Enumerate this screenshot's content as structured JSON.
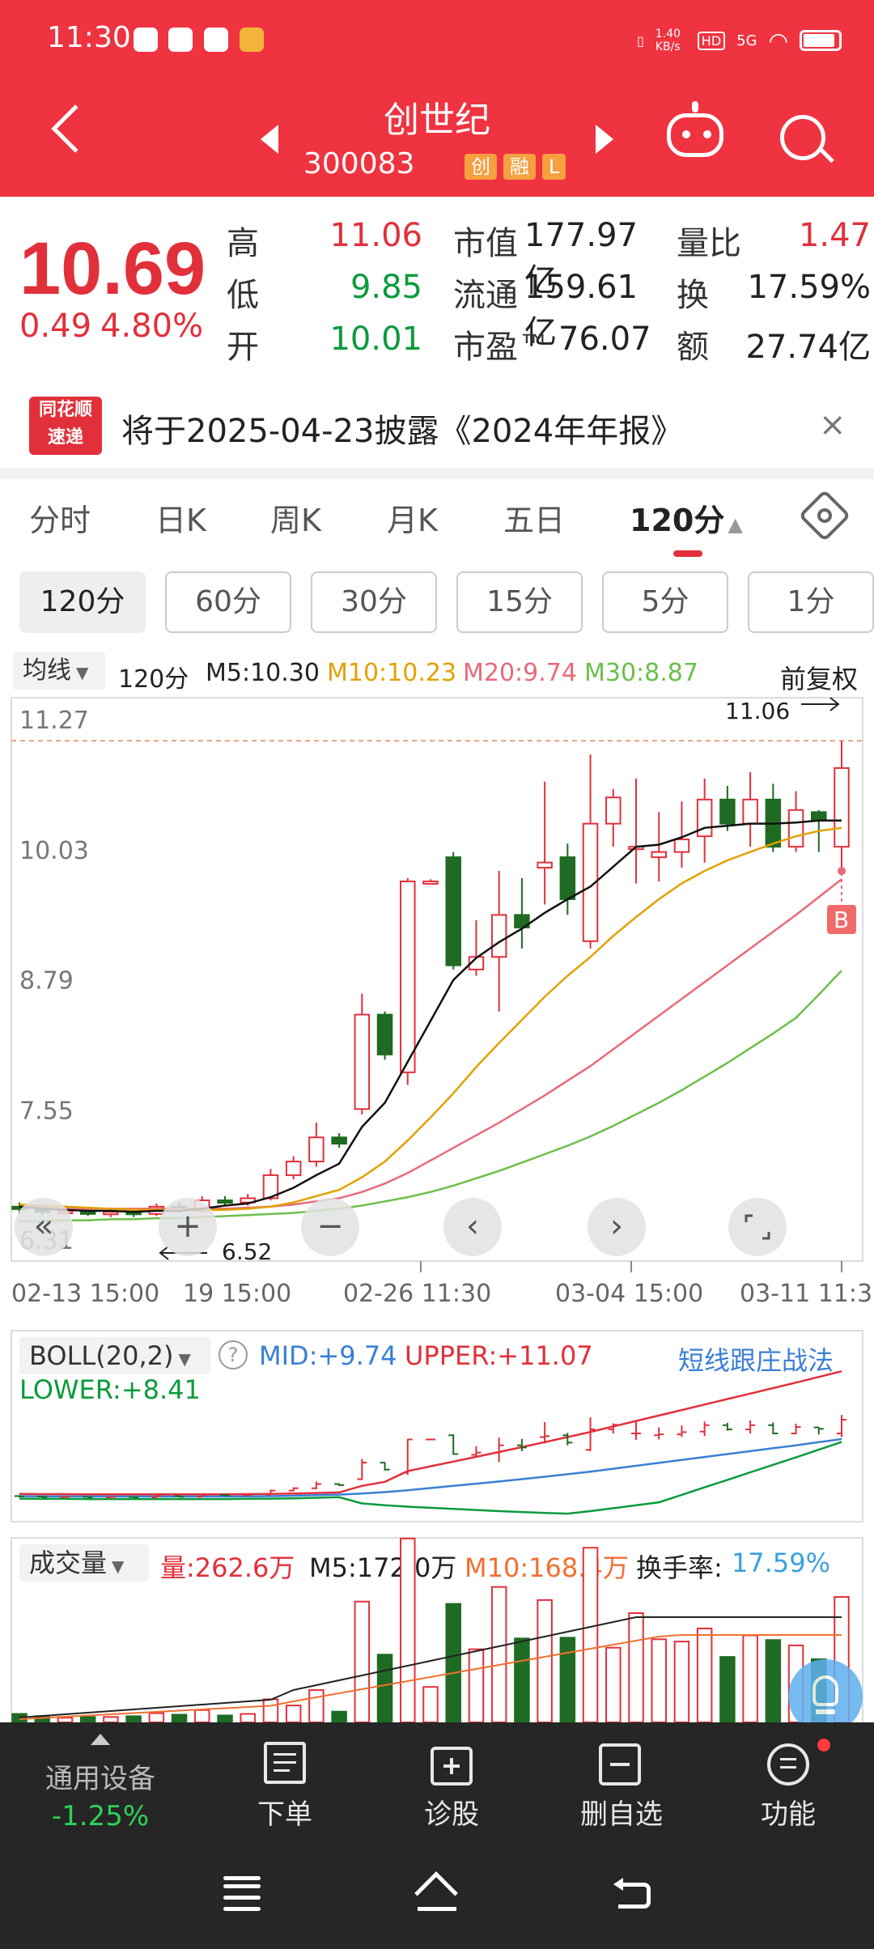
{
  "status": {
    "time": "11:30",
    "speed": "1.40\nKB/s",
    "hd": "HD",
    "signal": "5G"
  },
  "header": {
    "title": "创世纪",
    "code": "300083",
    "tags": [
      "创",
      "融",
      "L"
    ]
  },
  "quote": {
    "price": "10.69",
    "change": "0.49",
    "change_pct": "4.80%",
    "rows": [
      {
        "l1": "高",
        "v1": "11.06",
        "c1": "red",
        "l2": "市值",
        "v2": "177.97亿",
        "l3": "量比",
        "v3": "1.47",
        "c3": "red"
      },
      {
        "l1": "低",
        "v1": "9.85",
        "c1": "green",
        "l2": "流通",
        "v2": "159.61亿",
        "l3": "换",
        "v3": "17.59%",
        "c3": "dark"
      },
      {
        "l1": "开",
        "v1": "10.01",
        "c1": "green",
        "l2": "市盈™",
        "v2": "76.07",
        "l3": "额",
        "v3": "27.74亿",
        "c3": "dark"
      }
    ]
  },
  "notice": {
    "logo_top": "同花顺",
    "logo_bottom": "速递",
    "text": "将于2025-04-23披露《2024年年报》",
    "close": "×"
  },
  "tabs": [
    "分时",
    "日K",
    "周K",
    "月K",
    "五日",
    "120分"
  ],
  "periods": [
    "120分",
    "60分",
    "30分",
    "15分",
    "5分",
    "1分"
  ],
  "ma": {
    "select": "均线",
    "period": "120分",
    "m5": "M5:10.30",
    "m10": "M10:10.23",
    "m20": "M20:9.74",
    "m30": "M30:8.87",
    "adjust": "前复权"
  },
  "chart_data": {
    "type": "candlestick",
    "y_ticks": [
      "11.27",
      "10.03",
      "8.79",
      "7.55",
      "6.31"
    ],
    "ylim": [
      6.31,
      11.27
    ],
    "x_ticks": [
      "02-13 15:00",
      "19 15:00",
      "02-26 11:30",
      "03-04 15:00",
      "03-11 11:30"
    ],
    "high_label": "11.06",
    "low_label": "6.52",
    "buy_marker": "B",
    "colors": {
      "up": "#e2303b",
      "down": "#1f6b23",
      "m5": "#111111",
      "m10": "#e2a100",
      "m20": "#e86a7a",
      "m30": "#6cbf4a"
    },
    "candles": [
      {
        "o": 6.62,
        "c": 6.6,
        "h": 6.66,
        "l": 6.55
      },
      {
        "o": 6.6,
        "c": 6.57,
        "h": 6.62,
        "l": 6.54
      },
      {
        "o": 6.57,
        "c": 6.58,
        "h": 6.61,
        "l": 6.55
      },
      {
        "o": 6.58,
        "c": 6.55,
        "h": 6.6,
        "l": 6.53
      },
      {
        "o": 6.55,
        "c": 6.57,
        "h": 6.59,
        "l": 6.52
      },
      {
        "o": 6.57,
        "c": 6.55,
        "h": 6.6,
        "l": 6.52
      },
      {
        "o": 6.55,
        "c": 6.62,
        "h": 6.65,
        "l": 6.53
      },
      {
        "o": 6.62,
        "c": 6.58,
        "h": 6.66,
        "l": 6.56
      },
      {
        "o": 6.58,
        "c": 6.68,
        "h": 6.72,
        "l": 6.56
      },
      {
        "o": 6.68,
        "c": 6.66,
        "h": 6.72,
        "l": 6.63
      },
      {
        "o": 6.66,
        "c": 6.7,
        "h": 6.74,
        "l": 6.63
      },
      {
        "o": 6.7,
        "c": 6.92,
        "h": 6.98,
        "l": 6.68
      },
      {
        "o": 6.92,
        "c": 7.05,
        "h": 7.1,
        "l": 6.88
      },
      {
        "o": 7.05,
        "c": 7.28,
        "h": 7.42,
        "l": 7.0
      },
      {
        "o": 7.28,
        "c": 7.22,
        "h": 7.32,
        "l": 7.18
      },
      {
        "o": 7.55,
        "c": 8.45,
        "h": 8.65,
        "l": 7.5
      },
      {
        "o": 8.45,
        "c": 8.07,
        "h": 8.48,
        "l": 8.02
      },
      {
        "o": 7.9,
        "c": 9.72,
        "h": 9.75,
        "l": 7.78
      },
      {
        "o": 9.72,
        "c": 9.72,
        "h": 9.74,
        "l": 9.7
      },
      {
        "o": 9.95,
        "c": 8.92,
        "h": 10.0,
        "l": 8.88
      },
      {
        "o": 8.88,
        "c": 9.0,
        "h": 9.35,
        "l": 8.82
      },
      {
        "o": 9.0,
        "c": 9.4,
        "h": 9.82,
        "l": 8.48
      },
      {
        "o": 9.4,
        "c": 9.28,
        "h": 9.75,
        "l": 9.08
      },
      {
        "o": 9.85,
        "c": 9.9,
        "h": 10.67,
        "l": 9.5
      },
      {
        "o": 9.95,
        "c": 9.55,
        "h": 10.08,
        "l": 9.4
      },
      {
        "o": 9.15,
        "c": 10.27,
        "h": 10.93,
        "l": 9.08
      },
      {
        "o": 10.27,
        "c": 10.52,
        "h": 10.6,
        "l": 10.05
      },
      {
        "o": 10.05,
        "c": 10.05,
        "h": 10.7,
        "l": 9.7
      },
      {
        "o": 9.95,
        "c": 10.0,
        "h": 10.38,
        "l": 9.72
      },
      {
        "o": 10.0,
        "c": 10.12,
        "h": 10.48,
        "l": 9.85
      },
      {
        "o": 10.15,
        "c": 10.5,
        "h": 10.7,
        "l": 9.9
      },
      {
        "o": 10.5,
        "c": 10.27,
        "h": 10.63,
        "l": 10.2
      },
      {
        "o": 10.27,
        "c": 10.5,
        "h": 10.76,
        "l": 10.05
      },
      {
        "o": 10.5,
        "c": 10.05,
        "h": 10.65,
        "l": 10.0
      },
      {
        "o": 10.05,
        "c": 10.4,
        "h": 10.58,
        "l": 10.0
      },
      {
        "o": 10.38,
        "c": 10.3,
        "h": 10.4,
        "l": 10.0
      },
      {
        "o": 10.05,
        "c": 10.8,
        "h": 11.06,
        "l": 9.85
      }
    ],
    "ma5": [
      6.62,
      6.6,
      6.59,
      6.58,
      6.58,
      6.57,
      6.58,
      6.58,
      6.6,
      6.63,
      6.65,
      6.71,
      6.8,
      6.92,
      7.03,
      7.38,
      7.61,
      8.0,
      8.39,
      8.78,
      8.99,
      9.14,
      9.27,
      9.42,
      9.55,
      9.67,
      9.86,
      10.05,
      10.07,
      10.14,
      10.23,
      10.25,
      10.27,
      10.27,
      10.28,
      10.3,
      10.3
    ],
    "ma10": [
      6.64,
      6.63,
      6.62,
      6.61,
      6.6,
      6.59,
      6.59,
      6.59,
      6.59,
      6.59,
      6.6,
      6.62,
      6.66,
      6.72,
      6.78,
      6.9,
      7.05,
      7.25,
      7.47,
      7.7,
      7.95,
      8.18,
      8.4,
      8.62,
      8.82,
      9.0,
      9.2,
      9.38,
      9.55,
      9.7,
      9.82,
      9.92,
      10.0,
      10.08,
      10.15,
      10.2,
      10.23
    ],
    "ma20": [
      6.62,
      6.61,
      6.61,
      6.6,
      6.6,
      6.6,
      6.6,
      6.6,
      6.6,
      6.6,
      6.61,
      6.62,
      6.64,
      6.67,
      6.7,
      6.76,
      6.84,
      6.94,
      7.06,
      7.18,
      7.3,
      7.42,
      7.55,
      7.68,
      7.82,
      7.96,
      8.12,
      8.28,
      8.44,
      8.6,
      8.76,
      8.92,
      9.08,
      9.24,
      9.4,
      9.57,
      9.74
    ],
    "ma30": [
      6.48,
      6.48,
      6.49,
      6.49,
      6.5,
      6.5,
      6.51,
      6.51,
      6.52,
      6.53,
      6.54,
      6.55,
      6.56,
      6.58,
      6.6,
      6.63,
      6.67,
      6.71,
      6.76,
      6.82,
      6.89,
      6.96,
      7.04,
      7.12,
      7.2,
      7.29,
      7.39,
      7.5,
      7.61,
      7.73,
      7.86,
      7.99,
      8.13,
      8.27,
      8.42,
      8.64,
      8.87
    ],
    "overlay_buttons": [
      "«",
      "+",
      "−",
      "‹",
      "›"
    ]
  },
  "boll": {
    "select": "BOLL(20,2)",
    "help": "?",
    "mid": "MID:+9.74",
    "upper": "UPPER:+11.07",
    "lower": "LOWER:+8.41",
    "link": "短线跟庄战法"
  },
  "volume": {
    "select": "成交量",
    "vol": "量:262.6万",
    "m5": "M5:172.0万",
    "m10": "M10:168.4万",
    "turnover_label": "换手率:",
    "turnover": "17.59%"
  },
  "bottom": {
    "sector": "通用设备",
    "sector_change": "-1.25%",
    "items": [
      "下单",
      "诊股",
      "删自选",
      "功能"
    ]
  }
}
